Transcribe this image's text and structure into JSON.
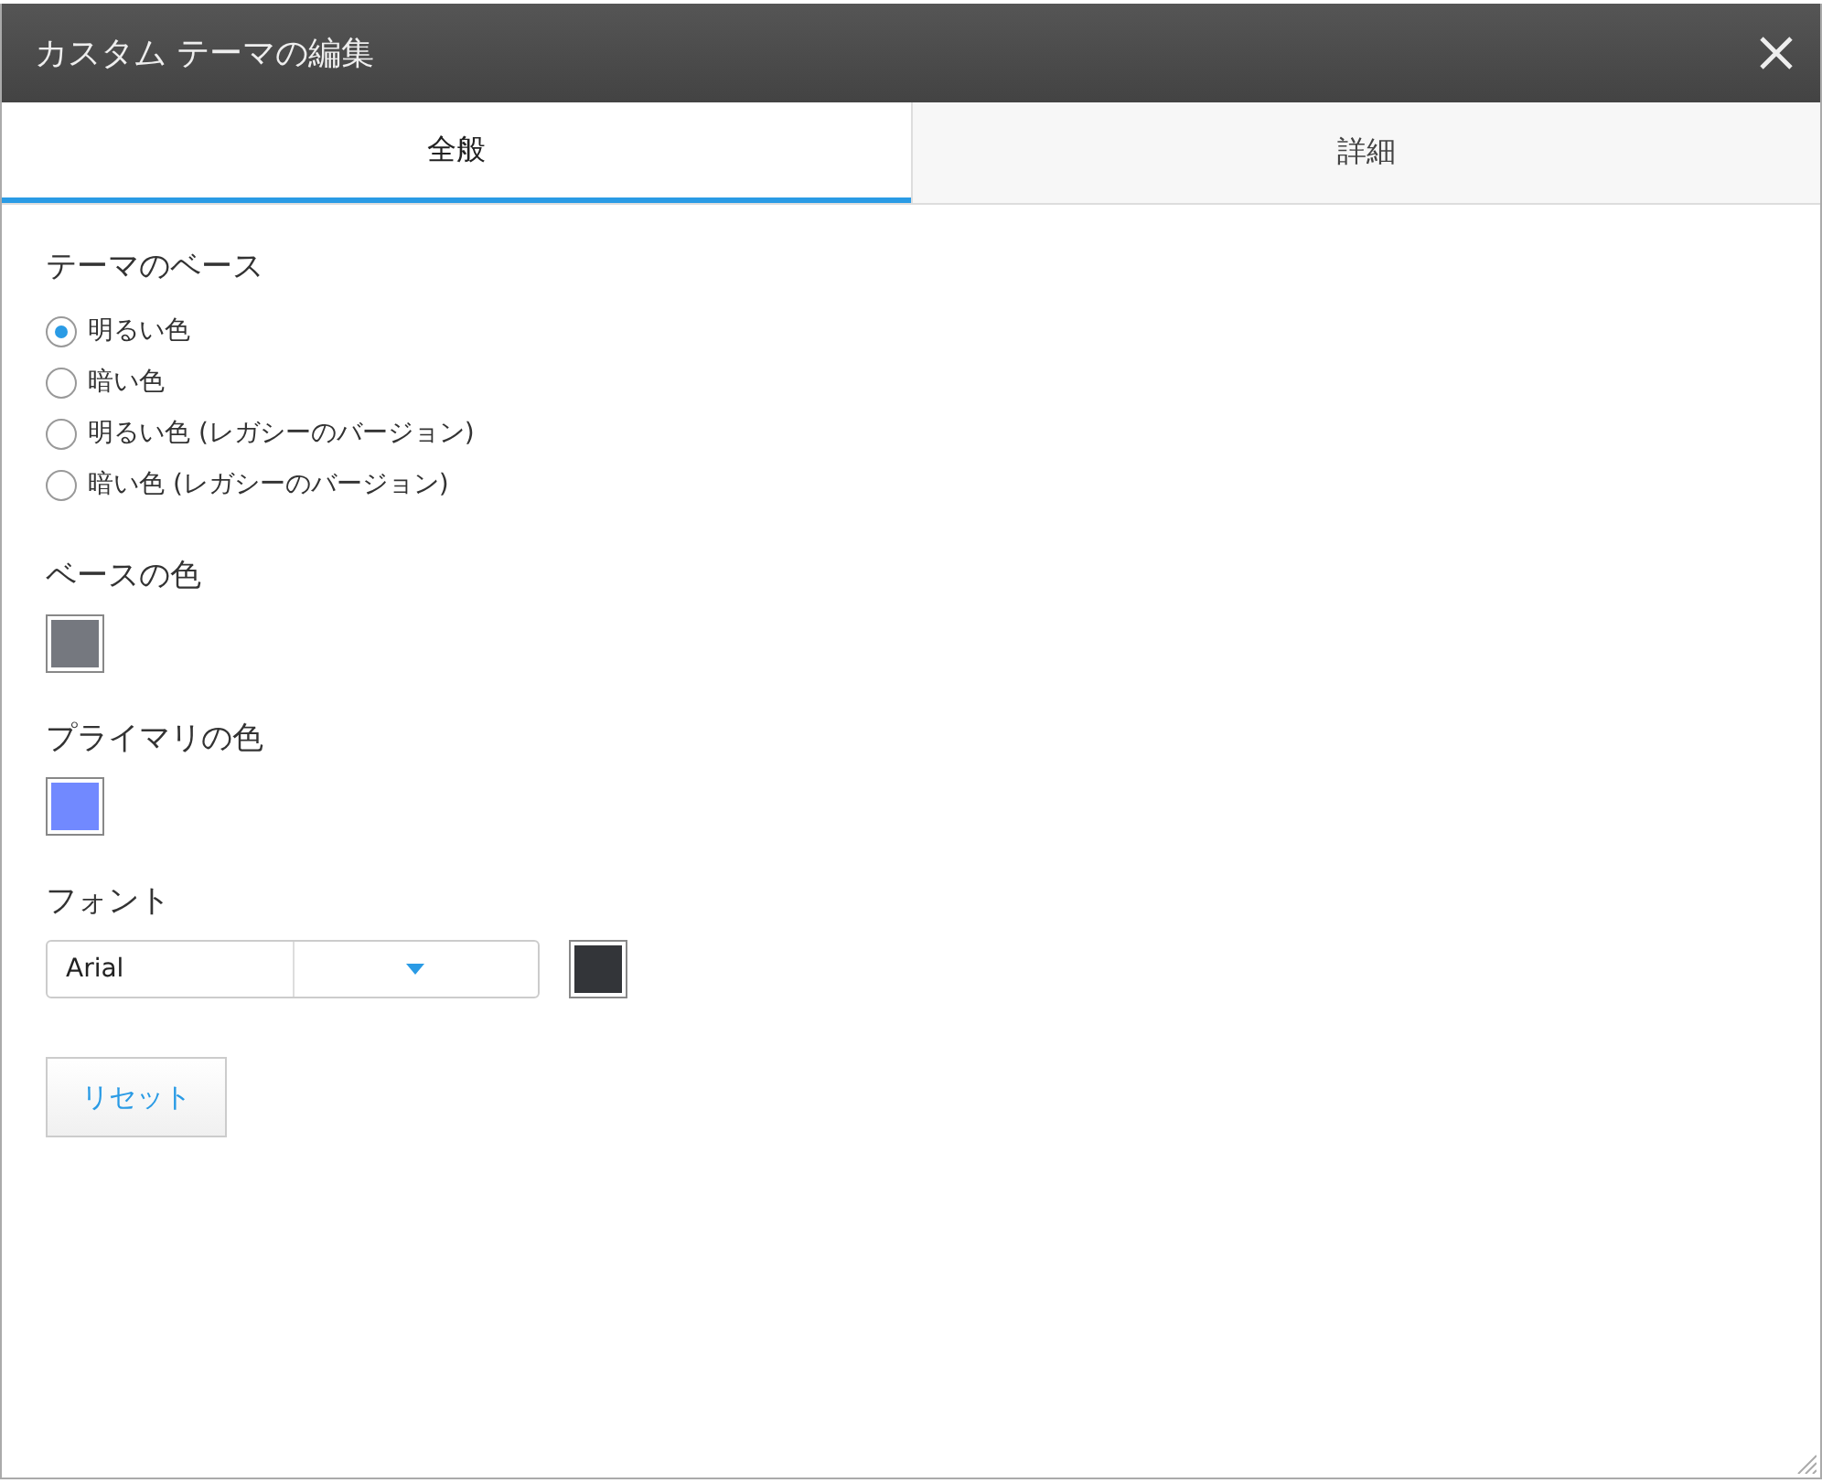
{
  "dialog": {
    "title": "カスタム テーマの編集"
  },
  "tabs": [
    {
      "label": "全般",
      "selected": true
    },
    {
      "label": "詳細",
      "selected": false
    }
  ],
  "sections": [
    {
      "kind": "radio",
      "label": "テーマのベース",
      "options": [
        {
          "label": "明るい色",
          "selected": true
        },
        {
          "label": "暗い色",
          "selected": false
        },
        {
          "label": "明るい色 (レガシーのバージョン)",
          "selected": false
        },
        {
          "label": "暗い色 (レガシーのバージョン)",
          "selected": false
        }
      ]
    },
    {
      "kind": "swatch",
      "label": "ベースの色",
      "color": "#75787f"
    },
    {
      "kind": "swatch",
      "label": "プライマリの色",
      "color": "#7189ff"
    },
    {
      "kind": "font",
      "label": "フォント",
      "value": "Arial",
      "color": "#333539"
    }
  ],
  "reset_button": "リセット"
}
